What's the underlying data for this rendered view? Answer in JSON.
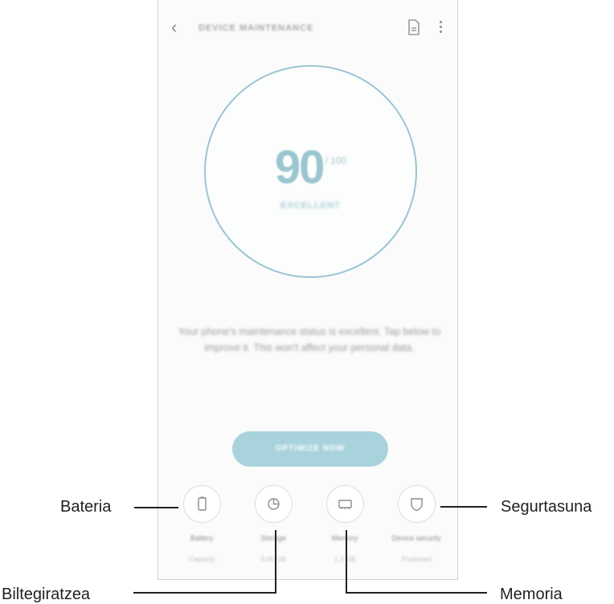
{
  "header": {
    "title": "DEVICE MAINTENANCE"
  },
  "score": {
    "value": "90",
    "suffix": "/ 100",
    "status": "EXCELLENT"
  },
  "description": "Your phone's maintenance status is excellent. Tap below to improve it. This won't affect your personal data.",
  "optimize_button": "OPTIMIZE NOW",
  "categories": [
    {
      "label": "Battery",
      "value": "Capacity"
    },
    {
      "label": "Storage",
      "value": "9.05 GB"
    },
    {
      "label": "Memory",
      "value": "1.3 GB"
    },
    {
      "label": "Device security",
      "value": "Protected"
    }
  ],
  "callouts": {
    "battery": "Bateria",
    "storage": "Biltegiratzea",
    "memory": "Memoria",
    "security": "Segurtasuna"
  },
  "colors": {
    "accent": "#9bc5d3",
    "button": "#a8d3dd"
  }
}
